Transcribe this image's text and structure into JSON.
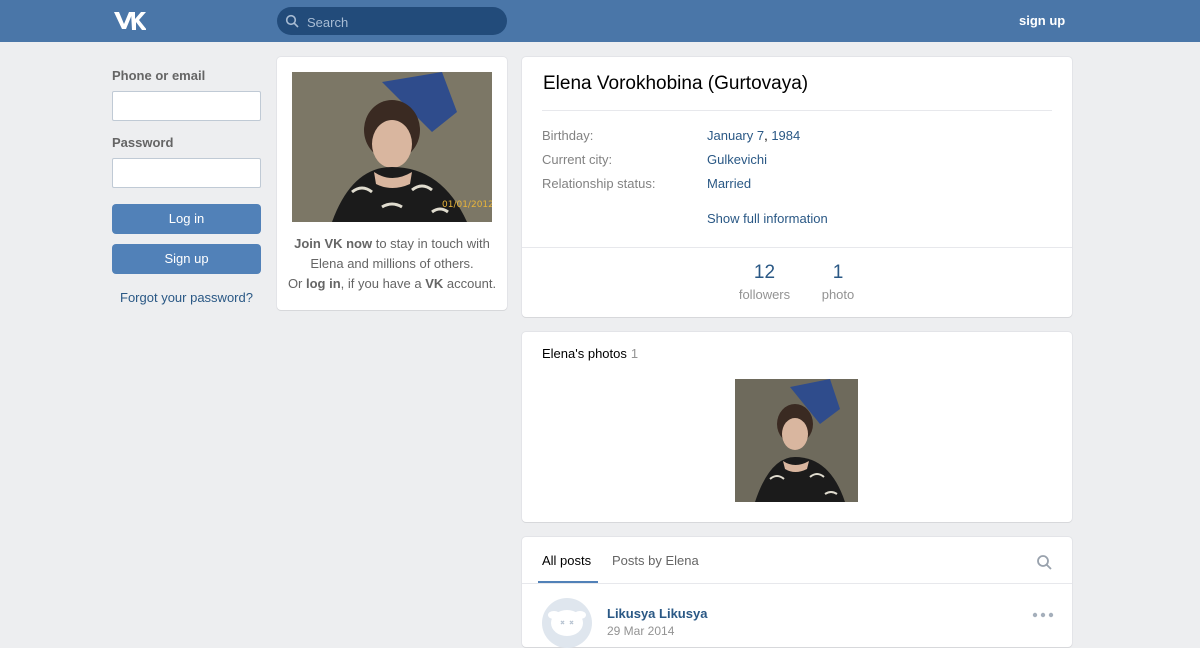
{
  "header": {
    "logo": "vk-logo-icon",
    "search_placeholder": "Search",
    "signup_label": "sign up",
    "accent_color": "#4a76a8"
  },
  "login": {
    "phone_label": "Phone or email",
    "password_label": "Password",
    "login_button": "Log in",
    "signup_button": "Sign up",
    "forgot_link": "Forgot your password?"
  },
  "profile_card": {
    "photo_date_stamp": "01/01/2012",
    "join_prefix_bold": "Join VK now",
    "join_rest": " to stay in touch with Elena and millions of others.",
    "or_text": "Or ",
    "login_bold": "log in",
    "if_text": ", if you have a ",
    "vk_bold": "VK",
    "account_text": " account."
  },
  "profile": {
    "name": "Elena Vorokhobina (Gurtovaya)",
    "rows": [
      {
        "label": "Birthday:",
        "value_a": "January 7",
        "sep": ", ",
        "value_b": "1984"
      },
      {
        "label": "Current city:",
        "value": "Gulkevichi"
      },
      {
        "label": "Relationship status:",
        "value": "Married"
      }
    ],
    "show_full": "Show full information",
    "counters": [
      {
        "number": "12",
        "caption": "followers"
      },
      {
        "number": "1",
        "caption": "photo"
      }
    ]
  },
  "photos": {
    "title": "Elena's photos",
    "count": "1"
  },
  "posts": {
    "tabs": [
      "All posts",
      "Posts by Elena"
    ],
    "active_tab": "All posts",
    "post": {
      "author": "Likusya Likusya",
      "date": "29 Mar 2014"
    }
  }
}
